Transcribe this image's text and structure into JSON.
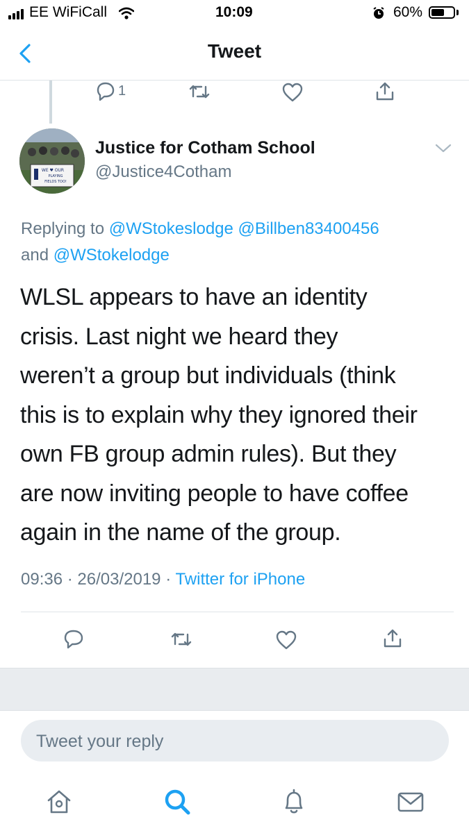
{
  "status_bar": {
    "carrier": "EE WiFiCall",
    "time": "10:09",
    "battery": "60%",
    "battery_level": 0.6
  },
  "nav": {
    "title": "Tweet"
  },
  "parent_actions": {
    "reply_count": "1"
  },
  "tweet": {
    "author_name": "Justice for Cotham School",
    "author_handle": "@Justice4Cotham",
    "avatar_sign": "WE ♥ OUR PLAYING FIELDS TOO!",
    "replying_prefix": "Replying to",
    "replying_users": [
      "@WStokeslodge",
      "@Billben83400456"
    ],
    "replying_and": "and",
    "replying_last": "@WStokelodge",
    "text_lines": [
      "WLSL appears to have an identity",
      "crisis. Last night we heard they",
      "weren’t a group but individuals (think",
      "this is to explain why they ignored their",
      "own FB group admin rules). But they",
      "are now inviting people to have coffee",
      "again in the name of the group."
    ],
    "time": "09:36",
    "date": "26/03/2019",
    "source": "Twitter for iPhone"
  },
  "reply": {
    "placeholder": "Tweet your reply"
  },
  "tabbar": {
    "icons": [
      "home-icon",
      "search-icon",
      "notifications-icon",
      "messages-icon"
    ]
  },
  "colors": {
    "accent": "#1da1f2",
    "secondary_text": "#657786",
    "divider": "#dfe3e7"
  }
}
